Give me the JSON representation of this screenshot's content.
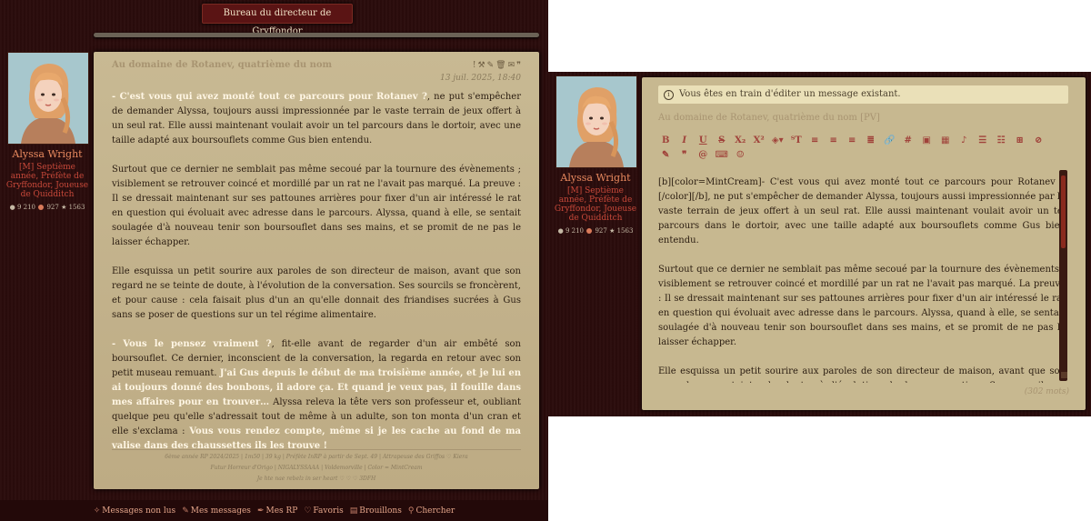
{
  "forum": {
    "title": "Bureau du directeur de Gryffondor"
  },
  "post": {
    "title": "Au domaine de Rotanev, quatrième du nom",
    "icons": [
      "exclamation-icon",
      "wrench-icon",
      "pencil-icon",
      "trash-icon",
      "mail-icon",
      "quote-icon"
    ],
    "date": "13 juil. 2025, 18:40",
    "author": {
      "name": "Alyssa Wright",
      "rank": "[M] Septième année, Préfète de Gryffondor, Joueuse de Quidditch",
      "stats": {
        "messages": "9 210",
        "points": "927",
        "stars": "1563"
      }
    },
    "paragraphs": [
      [
        {
          "t": "- C'est vous qui avez monté tout ce parcours pour Rotanev ?",
          "h": true
        },
        {
          "t": ", ne put s'empêcher de demander Alyssa, toujours aussi impressionnée par le vaste terrain de jeux offert à un seul rat. Elle aussi maintenant voulait avoir un tel parcours dans le dortoir, avec une taille adapté aux boursouflets comme Gus bien entendu.",
          "h": false
        }
      ],
      [
        {
          "t": "Surtout que ce dernier ne semblait pas même secoué par la tournure des évènements ; visiblement se retrouver coincé et mordillé par un rat ne l'avait pas marqué. La preuve : Il se dressait maintenant sur ses pattounes arrières pour fixer d'un air intéressé le rat en question qui évoluait avec adresse dans le parcours. Alyssa, quand à elle, se sentait soulagée d'à nouveau tenir son boursouflet dans ses mains, et se promit de ne pas le laisser échapper.",
          "h": false
        }
      ],
      [
        {
          "t": "Elle esquissa un petit sourire aux paroles de son directeur de maison, avant que son regard ne se teinte de doute, à l'évolution de la conversation. Ses sourcils se froncèrent, et pour cause : cela faisait plus d'un an qu'elle donnait des friandises sucrées à Gus sans se poser de questions sur un tel régime alimentaire.",
          "h": false
        }
      ],
      [
        {
          "t": "- Vous le pensez vraiment ?",
          "h": true
        },
        {
          "t": ", fit-elle avant de regarder d'un air embêté son boursouflet. Ce dernier, inconscient de la conversation, la regarda en retour avec son petit museau remuant. ",
          "h": false
        },
        {
          "t": "J'ai Gus depuis le début de ma troisième année, et je lui en ai toujours donné des bonbons, il adore ça. Et quand je veux pas, il fouille dans mes affaires pour en trouver…",
          "h": true
        },
        {
          "t": " Alyssa releva la tête vers son professeur et, oubliant quelque peu qu'elle s'adressait tout de même à un adulte, son ton monta d'un cran et elle s'exclama : ",
          "h": false
        },
        {
          "t": "Vous vous rendez compte, même si je les cache au fond de ma valise dans des chaussettes ils les trouve !",
          "h": true
        }
      ]
    ],
    "signature": [
      "6ème année RP 2024/2025 | 1m50 | 39 kg | Préfète InRP à partir de Sept. 49 | Attrapeuse des Griffos ♡ Kiera",
      "Futur Horreur d'Origo | NIGALYSSAAA | Voldemorville | Color = MintCream",
      "Je hte nae rebelz in ser heart ♡ ♡ ♡ 3DFH"
    ]
  },
  "bottom_nav": [
    {
      "icon": "sparkle-icon",
      "glyph": "✧",
      "label": "Messages non lus"
    },
    {
      "icon": "pen-icon",
      "glyph": "✎",
      "label": "Mes messages"
    },
    {
      "icon": "quill-icon",
      "glyph": "✒",
      "label": "Mes RP"
    },
    {
      "icon": "heart-icon",
      "glyph": "♡",
      "label": "Favoris"
    },
    {
      "icon": "drafts-icon",
      "glyph": "▤",
      "label": "Brouillons"
    },
    {
      "icon": "search-icon",
      "glyph": "⚲",
      "label": "Chercher"
    }
  ],
  "editor": {
    "notice": "Vous êtes en train d'éditer un message existant.",
    "notice_icon": "i",
    "subject": "Au domaine de Rotanev, quatrième du nom [PV]",
    "toolbar_row1": [
      {
        "name": "bold",
        "glyph": "B"
      },
      {
        "name": "italic",
        "glyph": "I"
      },
      {
        "name": "underline",
        "glyph": "U"
      },
      {
        "name": "strikethrough",
        "glyph": "S"
      },
      {
        "name": "subscript",
        "glyph": "X₂"
      },
      {
        "name": "superscript",
        "glyph": "X²"
      },
      {
        "name": "color",
        "glyph": "◈▾"
      },
      {
        "name": "font-size",
        "glyph": "ᵀT"
      },
      {
        "name": "align-left",
        "glyph": "≡"
      },
      {
        "name": "align-center",
        "glyph": "≡"
      },
      {
        "name": "align-right",
        "glyph": "≡"
      },
      {
        "name": "justify",
        "glyph": "≣"
      },
      {
        "name": "link",
        "glyph": "🔗"
      },
      {
        "name": "hashtag",
        "glyph": "#"
      },
      {
        "name": "image",
        "glyph": "▣"
      },
      {
        "name": "video",
        "glyph": "▦"
      },
      {
        "name": "music",
        "glyph": "♪"
      },
      {
        "name": "bullet-list",
        "glyph": "☰"
      },
      {
        "name": "numbered-list",
        "glyph": "☷"
      },
      {
        "name": "table",
        "glyph": "⊞"
      },
      {
        "name": "hide",
        "glyph": "⊘"
      }
    ],
    "toolbar_row2": [
      {
        "name": "magic",
        "glyph": "✎"
      },
      {
        "name": "quote",
        "glyph": "❞"
      },
      {
        "name": "mention",
        "glyph": "@"
      },
      {
        "name": "code",
        "glyph": "⌨"
      },
      {
        "name": "emoji",
        "glyph": "☺"
      }
    ],
    "content": [
      "[b][color=MintCream]- C'est vous qui avez monté tout ce parcours pour Rotanev ?[/color][/b], ne put s'empêcher de demander Alyssa, toujours aussi impressionnée par le vaste terrain de jeux offert à un seul rat. Elle aussi maintenant voulait avoir un tel parcours dans le dortoir, avec une taille adapté aux boursouflets comme Gus bien entendu.",
      "Surtout que ce dernier ne semblait pas même secoué par la tournure des évènements ; visiblement se retrouver coincé et mordillé par un rat ne l'avait pas marqué. La preuve : Il se dressait maintenant sur ses pattounes arrières pour fixer d'un air intéressé le rat en question qui évoluait avec adresse dans le parcours. Alyssa, quand à elle, se sentait soulagée d'à nouveau tenir son boursouflet dans ses mains, et se promit de ne pas le laisser échapper.",
      "Elle esquissa un petit sourire aux paroles de son directeur de maison, avant que son regard ne se teinte de doute, à l'évolution de la conversation. Ses sourcils se froncèrent, et pour cause : cela faisait plus d'un an qu'elle donnait des friandises sucrées à Gus sans se poser de"
    ],
    "word_count": "(302 mots)"
  },
  "colors": {
    "background": "#2b0c0c",
    "parchment": "#c0b08a",
    "highlight": "#fff6e4",
    "accent": "#c9493a",
    "username": "#e98a5f"
  }
}
